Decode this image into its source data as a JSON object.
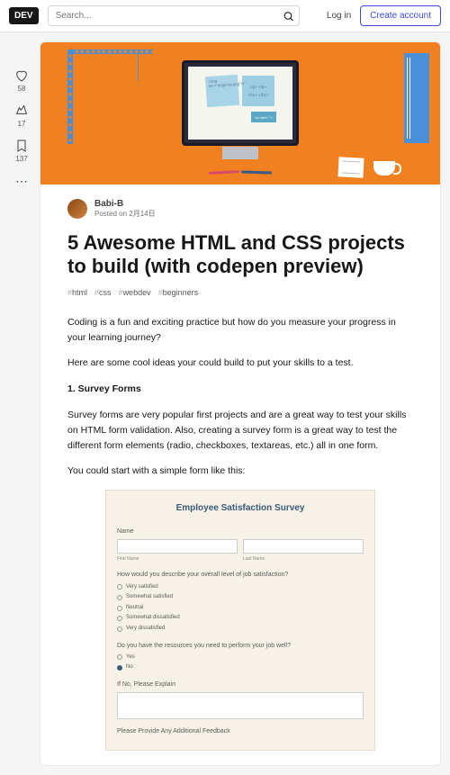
{
  "header": {
    "logo": "DEV",
    "search_placeholder": "Search...",
    "login": "Log in",
    "create": "Create account"
  },
  "sidebar": {
    "likes": "58",
    "unicorns": "17",
    "bookmarks": "137"
  },
  "article": {
    "author": "Babi-B",
    "posted_prefix": "Posted on ",
    "posted_date": "2月14日",
    "title": "5 Awesome HTML and CSS projects to build (with codepen preview)",
    "tags": [
      "html",
      "css",
      "webdev",
      "beginners"
    ],
    "p1": "Coding is a fun and exciting practice but how do you measure your progress in your learning journey?",
    "p2": "Here are some cool ideas your could build to put your skills to a test.",
    "h1": "1. Survey Forms",
    "p3": "Survey forms are very popular first projects and are a great way to test your skills on HTML form validation. Also, creating a survey form is a great way to test the different form elements (radio, checkboxes, textareas, etc.) all in one form.",
    "p4": "You could start with a simple form like this:"
  },
  "hero": {
    "note1": "<img src=\"img/img.png\"/>",
    "note2a": "<p> </p>",
    "note2b": "<h1> </h1>",
    "note3": "<a href=\"\">"
  },
  "embed": {
    "title": "Employee Satisfaction Survey",
    "name_label": "Name",
    "first": "First Name",
    "last": "Last Name",
    "q1": "How would you describe your overall level of job satisfaction?",
    "opts": [
      "Very satisfied",
      "Somewhat satisfied",
      "Neutral",
      "Somewhat dissatisfied",
      "Very dissatisfied"
    ],
    "q2": "Do you have the resources you need to perform your job well?",
    "yes": "Yes",
    "no": "No",
    "q3": "If No, Please Explain",
    "q4": "Please Provide Any Additional Feedback"
  }
}
